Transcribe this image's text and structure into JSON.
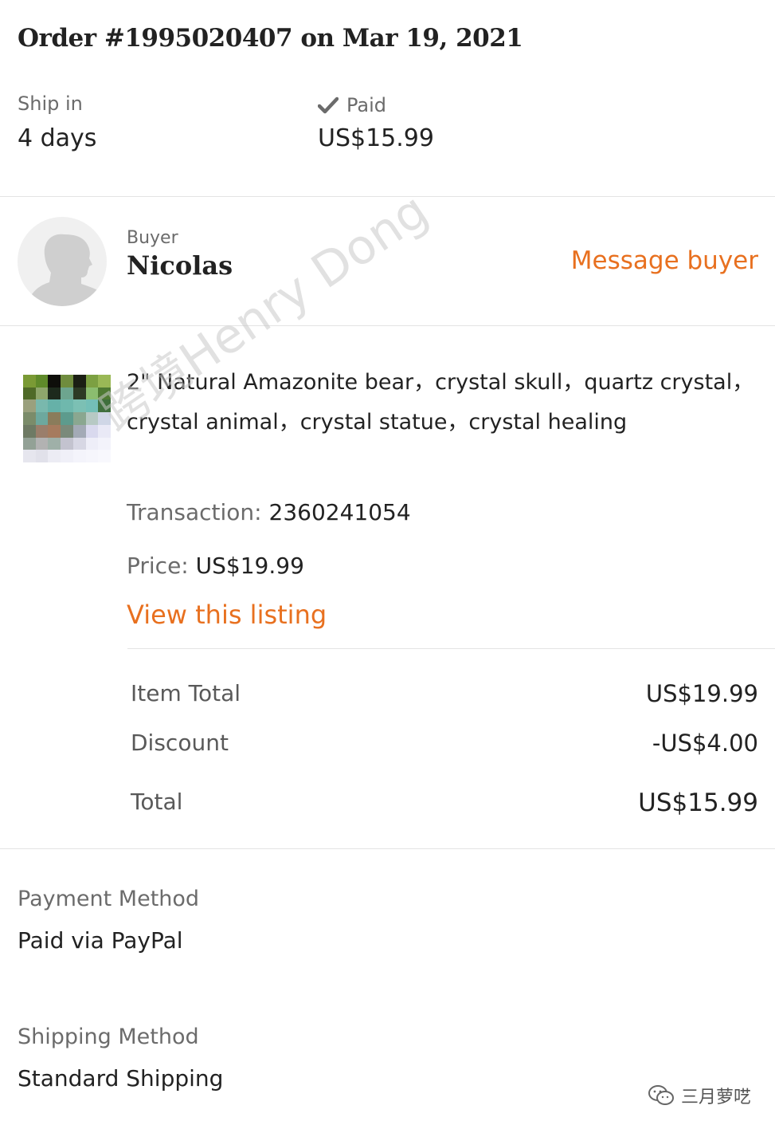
{
  "order": {
    "title": "Order #1995020407 on Mar 19, 2021"
  },
  "summary": {
    "ship_label": "Ship in",
    "ship_value": "4 days",
    "paid_label": "Paid",
    "paid_value": "US$15.99",
    "paid_icon": "check-icon"
  },
  "buyer": {
    "label": "Buyer",
    "name": "Nicolas",
    "message_label": "Message buyer",
    "avatar_icon": "person-silhouette-icon"
  },
  "item": {
    "title": "2\" Natural Amazonite bear，crystal skull，quartz crystal，crystal animal，crystal statue，crystal healing",
    "transaction_label": "Transaction:",
    "transaction_value": "2360241054",
    "price_label": "Price:",
    "price_value": "US$19.99",
    "view_listing_label": "View this listing"
  },
  "totals": {
    "item_total_label": "Item Total",
    "item_total_value": "US$19.99",
    "discount_label": "Discount",
    "discount_value": "-US$4.00",
    "total_label": "Total",
    "total_value": "US$15.99"
  },
  "payment": {
    "label": "Payment Method",
    "value": "Paid via PayPal"
  },
  "shipping": {
    "label": "Shipping Method",
    "value": "Standard Shipping"
  },
  "overlay": {
    "watermark": "跨境Henry Dong",
    "wechat_account": "三月萝呓"
  },
  "colors": {
    "accent": "#e8701f",
    "muted_text": "#6b6b6b",
    "text": "#222222",
    "divider": "#e4e4e4"
  }
}
